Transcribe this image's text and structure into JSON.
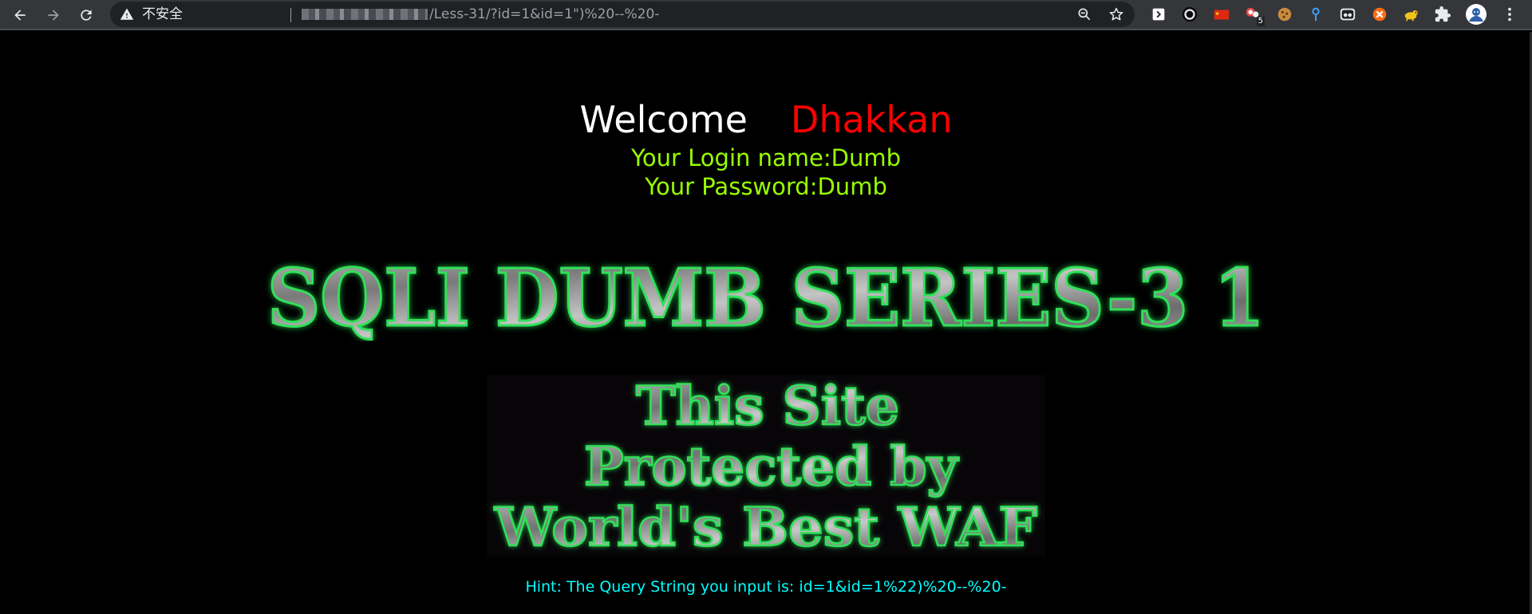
{
  "browser": {
    "security_label": "不安全",
    "url_path": "/Less-31/?id=1&id=1\")%20--%20-",
    "extensions": [
      {
        "name": "dark-reader-icon",
        "badge": ""
      },
      {
        "name": "record-icon",
        "badge": ""
      },
      {
        "name": "china-flag-icon",
        "badge": ""
      },
      {
        "name": "extension-badge-icon",
        "badge": "5"
      },
      {
        "name": "cookie-icon",
        "badge": ""
      },
      {
        "name": "location-pin-icon",
        "badge": ""
      },
      {
        "name": "eyes-icon",
        "badge": ""
      },
      {
        "name": "orange-x-icon",
        "badge": ""
      },
      {
        "name": "yellow-dog-icon",
        "badge": ""
      }
    ]
  },
  "page": {
    "welcome_word": "Welcome",
    "welcome_name": "Dhakkan",
    "login_name_line": "Your Login name:Dumb",
    "password_line": "Your Password:Dumb",
    "banner_title": "SQLI DUMB SERIES-3 1",
    "banner_waf_lines": [
      "This Site",
      "Protected by",
      "World's Best WAF"
    ],
    "hint": "Hint: The Query String you input is: id=1&id=1%22)%20--%20-"
  },
  "colors": {
    "background": "#000000",
    "welcome": "#ffffff",
    "name": "#ff0000",
    "login": "#99ff00",
    "hint": "#00ffff",
    "banner_glow": "#1fcf4a",
    "banner_fill": "#8a8a8a"
  }
}
